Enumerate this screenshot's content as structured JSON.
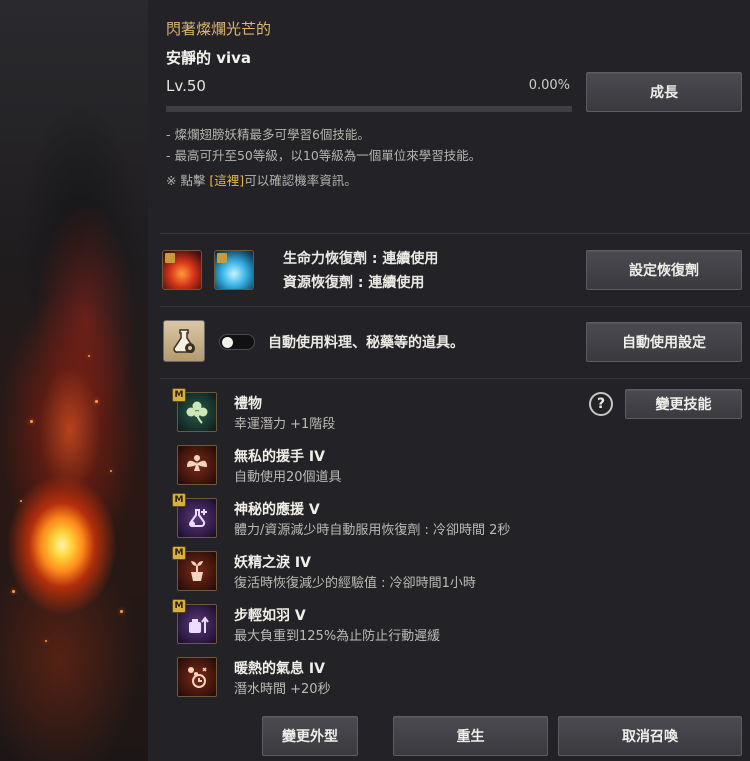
{
  "pet": {
    "title": "閃著燦爛光芒的",
    "name": "安靜的 viva",
    "level": "Lv.50",
    "exp_percent": "0.00%",
    "exp_progress": 0.0
  },
  "buttons": {
    "grow": "成長",
    "set_potion": "設定恢復劑",
    "auto_use_settings": "自動使用設定",
    "change_skill": "變更技能",
    "change_look": "變更外型",
    "rebirth": "重生",
    "cancel_summon": "取消召喚"
  },
  "info": {
    "line1": "- 燦爛翅膀妖精最多可學習6個技能。",
    "line2": "- 最高可升至50等級，以10等級為一個單位來學習技能。",
    "line3_prefix": "※ 點擊 ",
    "line3_link": "[這裡]",
    "line3_suffix": "可以確認機率資訊。"
  },
  "potions": {
    "hp": "生命力恢復劑 : 連續使用",
    "resource": "資源恢復劑 : 連續使用"
  },
  "auto_use": {
    "label": "自動使用料理、秘藥等的道具。",
    "enabled": false
  },
  "help_icon": "?",
  "skills": [
    {
      "name": "禮物",
      "desc": "幸運潛力 +1階段",
      "master": true,
      "icon": "clover-icon"
    },
    {
      "name": "無私的援手 IV",
      "desc": "自動使用20個道具",
      "master": false,
      "icon": "fairy-icon"
    },
    {
      "name": "神秘的應援 V",
      "desc": "體力/資源減少時自動服用恢復劑 : 冷卻時間 2秒",
      "master": true,
      "icon": "potion-plus-icon"
    },
    {
      "name": "妖精之淚 IV",
      "desc": "復活時恢復減少的經驗值 : 冷卻時間1小時",
      "master": true,
      "icon": "tear-sprout-icon"
    },
    {
      "name": "步輕如羽 V",
      "desc": "最大負重到125%為止防止行動遲緩",
      "master": true,
      "icon": "weight-arrow-icon"
    },
    {
      "name": "暖熱的氣息 IV",
      "desc": "潛水時間 +20秒",
      "master": false,
      "icon": "breath-timer-icon"
    }
  ],
  "badge_label": "M"
}
